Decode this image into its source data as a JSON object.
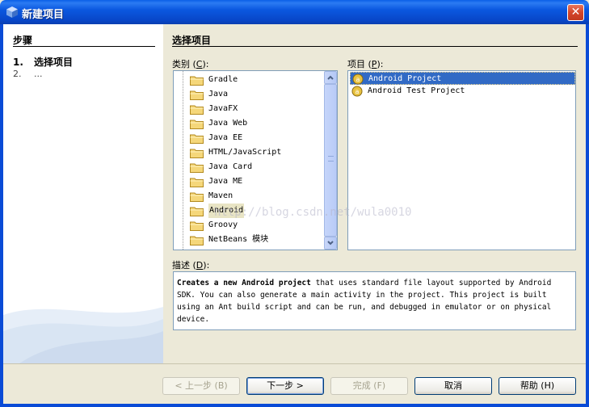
{
  "window": {
    "title": "新建项目",
    "close_label": "✕"
  },
  "steps": {
    "title": "步骤",
    "items": [
      {
        "num": "1.",
        "label": "选择项目"
      },
      {
        "num": "2.",
        "label": "..."
      }
    ]
  },
  "main": {
    "title": "选择项目",
    "categories_label_pre": "类别 (",
    "categories_label_key": "C",
    "categories_label_post": "):",
    "projects_label_pre": "项目 (",
    "projects_label_key": "P",
    "projects_label_post": "):",
    "description_label_pre": "描述 (",
    "description_label_key": "D",
    "description_label_post": "):",
    "categories": [
      "Gradle",
      "Java",
      "JavaFX",
      "Java Web",
      "Java EE",
      "HTML/JavaScript",
      "Java Card",
      "Java ME",
      "Maven",
      "Android",
      "Groovy",
      "NetBeans 模块",
      "..."
    ],
    "selected_category": "Android",
    "projects": [
      "Android Project",
      "Android Test Project"
    ],
    "selected_project": "Android Project",
    "description_bold": "Creates a new Android project",
    "description_rest": " that uses standard file layout supported by Android SDK. You can also generate a main activity in the project. This project is built using an Ant build script and can be run, and debugged in emulator or on physical device."
  },
  "watermark": "http://blog.csdn.net/wula0010",
  "buttons": {
    "back": "< 上一步 (B)",
    "next": "下一步 >",
    "finish": "完成 (F)",
    "cancel": "取消",
    "help": "帮助 (H)"
  },
  "colors": {
    "titlebar": "#0a4bd6",
    "selection": "#316ac5",
    "border": "#7f9db9"
  }
}
